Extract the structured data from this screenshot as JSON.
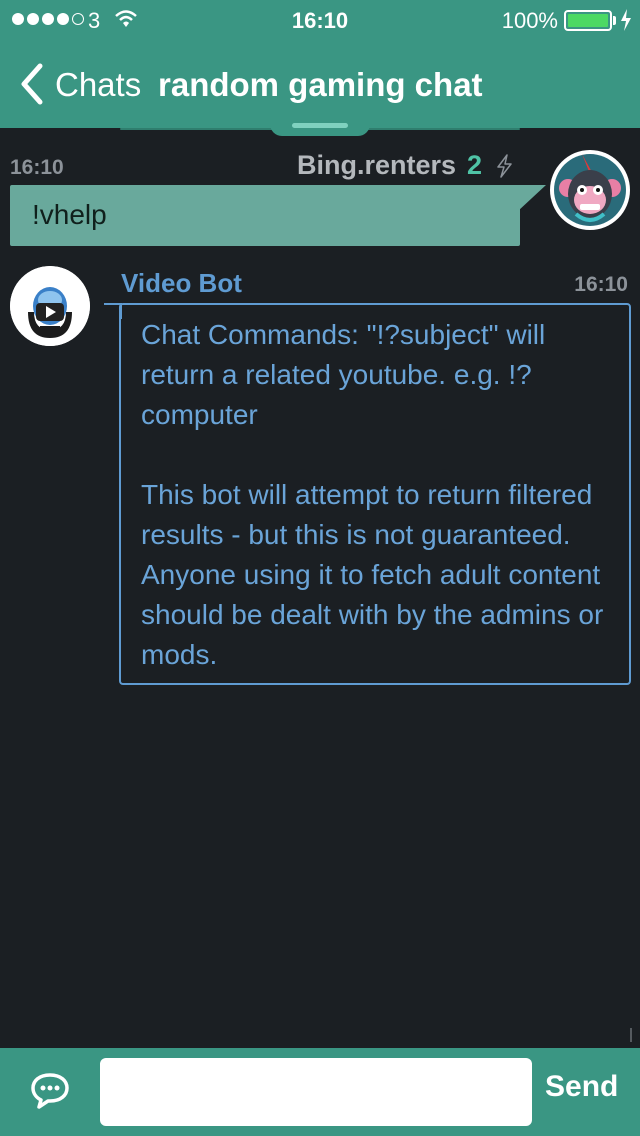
{
  "status_bar": {
    "carrier": "3",
    "time": "16:10",
    "battery": "100%",
    "signal_bars_filled": 4,
    "signal_bars_total": 5
  },
  "nav": {
    "back_label": "Chats",
    "title": "random gaming chat"
  },
  "messages": [
    {
      "time": "16:10",
      "sender": "Bing.renters",
      "count": "2",
      "text": "!vhelp"
    },
    {
      "sender": "Video Bot",
      "time": "16:10",
      "paragraphs": [
        "Chat Commands: \"!?subject\" will return a related youtube. e.g. !?computer",
        "This bot will attempt to return filtered results - but this is not guaranteed.  Anyone using it to fetch adult content should be dealt with by the admins or mods."
      ]
    }
  ],
  "composer": {
    "input_value": "",
    "send_label": "Send"
  },
  "colors": {
    "header": "#3a9683",
    "background": "#1b1f23",
    "outgoing_bubble": "#69a99c",
    "bot_text": "#6aa4d8"
  },
  "icons": [
    "back-chevron-icon",
    "wifi-icon",
    "lightning-bolt-icon",
    "chat-bubble-icon",
    "video-bot-avatar",
    "monkey-avatar"
  ]
}
